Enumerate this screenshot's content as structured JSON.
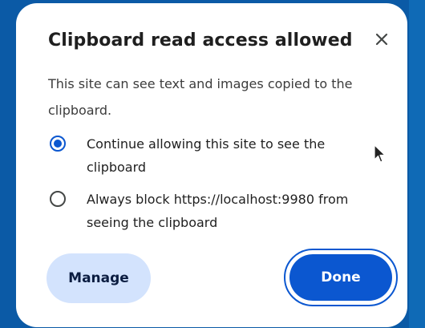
{
  "dialog": {
    "title": "Clipboard read access allowed",
    "description": "This site can see text and images copied to the clipboard.",
    "close_icon": "close-icon"
  },
  "options": [
    {
      "label": "Continue allowing this site to see the clipboard",
      "checked": true
    },
    {
      "label": "Always block https://localhost:9980 from seeing the clipboard",
      "checked": false
    }
  ],
  "buttons": {
    "manage_label": "Manage",
    "done_label": "Done"
  },
  "colors": {
    "background": "#0b5aa6",
    "accent": "#0b57d0",
    "manage_bg": "#d3e3fd"
  }
}
